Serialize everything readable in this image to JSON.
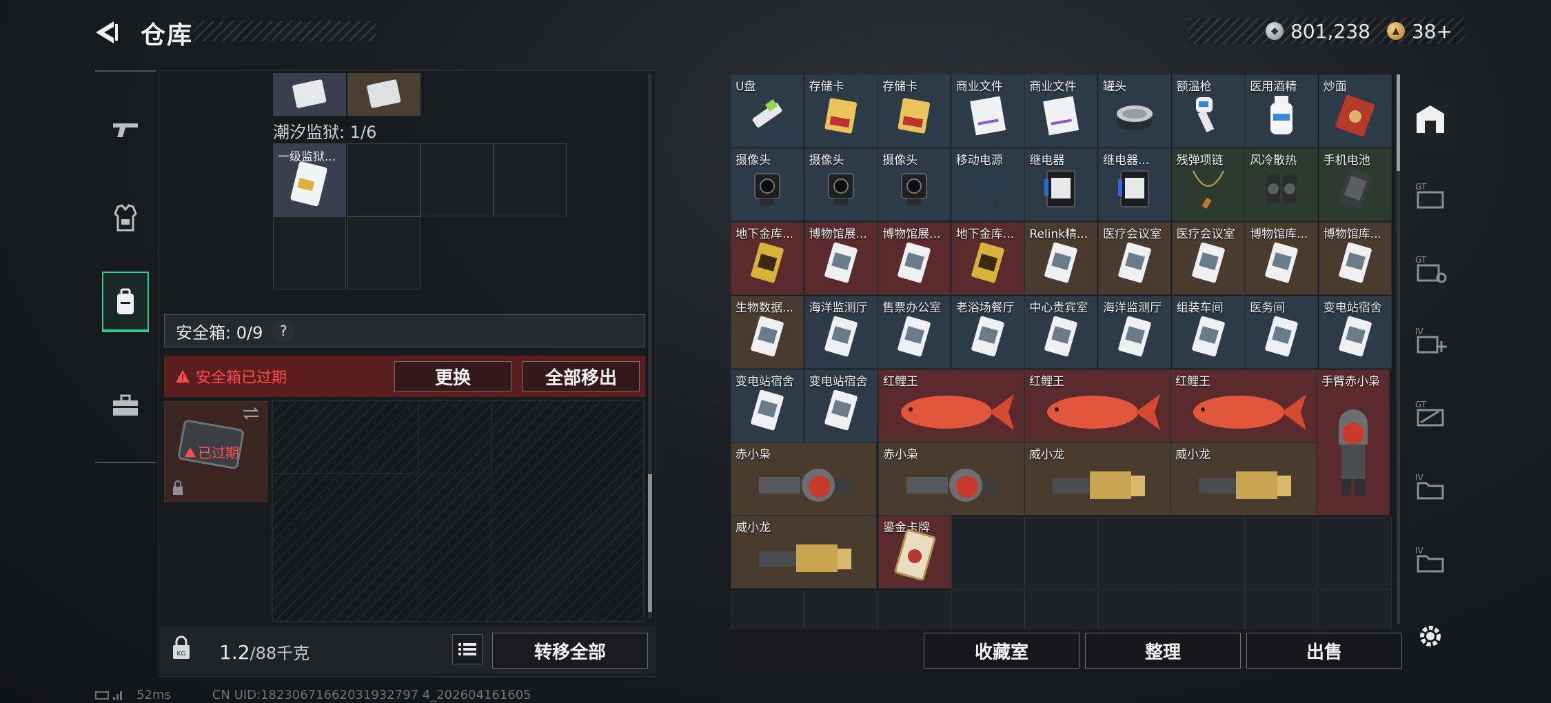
{
  "header": {
    "title": "仓库",
    "silver_amount": "801,238",
    "gold_amount": "38+"
  },
  "left": {
    "zone_label": "潮汐监狱: 1/6",
    "zone_item_label": "一级监狱...",
    "safebox_label": "安全箱: 0/9",
    "help_symbol": "?",
    "expired_notice": "安全箱已过期",
    "replace_button": "更换",
    "move_all_out_button": "全部移出",
    "expired_tag": "已过期",
    "weight_current": "1.2",
    "weight_max": "/88千克",
    "transfer_all_button": "转移全部"
  },
  "right": {
    "items": [
      {
        "label": "U盘",
        "icon": "usb-drive-icon",
        "bg": "blue"
      },
      {
        "label": "存储卡",
        "icon": "memory-card-icon",
        "bg": "blue"
      },
      {
        "label": "存储卡",
        "icon": "memory-card-icon",
        "bg": "blue"
      },
      {
        "label": "商业文件",
        "icon": "document-icon",
        "bg": "blue"
      },
      {
        "label": "商业文件",
        "icon": "document-icon",
        "bg": "blue"
      },
      {
        "label": "罐头",
        "icon": "can-icon",
        "bg": "blue"
      },
      {
        "label": "额温枪",
        "icon": "thermometer-gun-icon",
        "bg": "blue"
      },
      {
        "label": "医用酒精",
        "icon": "alcohol-bottle-icon",
        "bg": "blue"
      },
      {
        "label": "炒面",
        "icon": "noodle-pack-icon",
        "bg": "blue"
      },
      {
        "label": "摄像头",
        "icon": "camera-icon",
        "bg": "blue"
      },
      {
        "label": "摄像头",
        "icon": "camera-icon",
        "bg": "blue"
      },
      {
        "label": "摄像头",
        "icon": "camera-icon",
        "bg": "blue"
      },
      {
        "label": "移动电源",
        "icon": "power-bank-icon",
        "bg": "blue"
      },
      {
        "label": "继电器",
        "icon": "relay-icon",
        "bg": "blue"
      },
      {
        "label": "继电器...",
        "icon": "relay-icon",
        "bg": "blue"
      },
      {
        "label": "残弹项链",
        "icon": "necklace-icon",
        "bg": "green"
      },
      {
        "label": "风冷散热",
        "icon": "cooler-icon",
        "bg": "green"
      },
      {
        "label": "手机电池",
        "icon": "phone-battery-icon",
        "bg": "green"
      },
      {
        "label": "地下金库...",
        "icon": "gold-keycard-icon",
        "bg": "red"
      },
      {
        "label": "博物馆展...",
        "icon": "keycard-icon",
        "bg": "red"
      },
      {
        "label": "博物馆展...",
        "icon": "keycard-icon",
        "bg": "red"
      },
      {
        "label": "地下金库...",
        "icon": "gold-keycard-icon",
        "bg": "red"
      },
      {
        "label": "Relink精...",
        "icon": "keycard-icon",
        "bg": "tan"
      },
      {
        "label": "医疗会议室",
        "icon": "keycard-icon",
        "bg": "tan"
      },
      {
        "label": "医疗会议室",
        "icon": "keycard-icon",
        "bg": "tan"
      },
      {
        "label": "博物馆库...",
        "icon": "keycard-icon",
        "bg": "tan"
      },
      {
        "label": "博物馆库...",
        "icon": "keycard-icon",
        "bg": "tan"
      },
      {
        "label": "生物数据...",
        "icon": "keycard-icon",
        "bg": "tan"
      },
      {
        "label": "海洋监测厅",
        "icon": "keycard-icon",
        "bg": "blue"
      },
      {
        "label": "售票办公室",
        "icon": "keycard-icon",
        "bg": "blue"
      },
      {
        "label": "老浴场餐厅",
        "icon": "keycard-icon",
        "bg": "blue"
      },
      {
        "label": "中心贵宾室",
        "icon": "keycard-icon",
        "bg": "blue"
      },
      {
        "label": "海洋监测厅",
        "icon": "keycard-icon",
        "bg": "blue"
      },
      {
        "label": "组装车间",
        "icon": "keycard-icon",
        "bg": "blue"
      },
      {
        "label": "医务间",
        "icon": "keycard-icon",
        "bg": "blue"
      },
      {
        "label": "变电站宿舍",
        "icon": "keycard-icon",
        "bg": "blue"
      },
      {
        "label": "变电站宿舍",
        "icon": "keycard-icon",
        "bg": "blue"
      },
      {
        "label": "变电站宿舍",
        "icon": "keycard-icon",
        "bg": "blue"
      }
    ],
    "fish": [
      {
        "label": "红鲤王"
      },
      {
        "label": "红鲤王"
      },
      {
        "label": "红鲤王"
      }
    ],
    "tall_item_label": "手臂赤小枭",
    "wide_items": [
      {
        "label": "赤小枭",
        "icon": "figure-red-icon"
      },
      {
        "label": "赤小枭",
        "icon": "figure-red-icon"
      },
      {
        "label": "威小龙",
        "icon": "figure-gold-icon"
      },
      {
        "label": "威小龙",
        "icon": "figure-gold-icon"
      },
      {
        "label": "威小龙",
        "icon": "figure-gold-icon"
      }
    ],
    "card_label": "鎏金卡牌",
    "collection_button": "收藏室",
    "organize_button": "整理",
    "sell_button": "出售"
  },
  "status": {
    "ping": "52ms",
    "uid": "CN UID:18230671662031932797 4_202604161605"
  }
}
